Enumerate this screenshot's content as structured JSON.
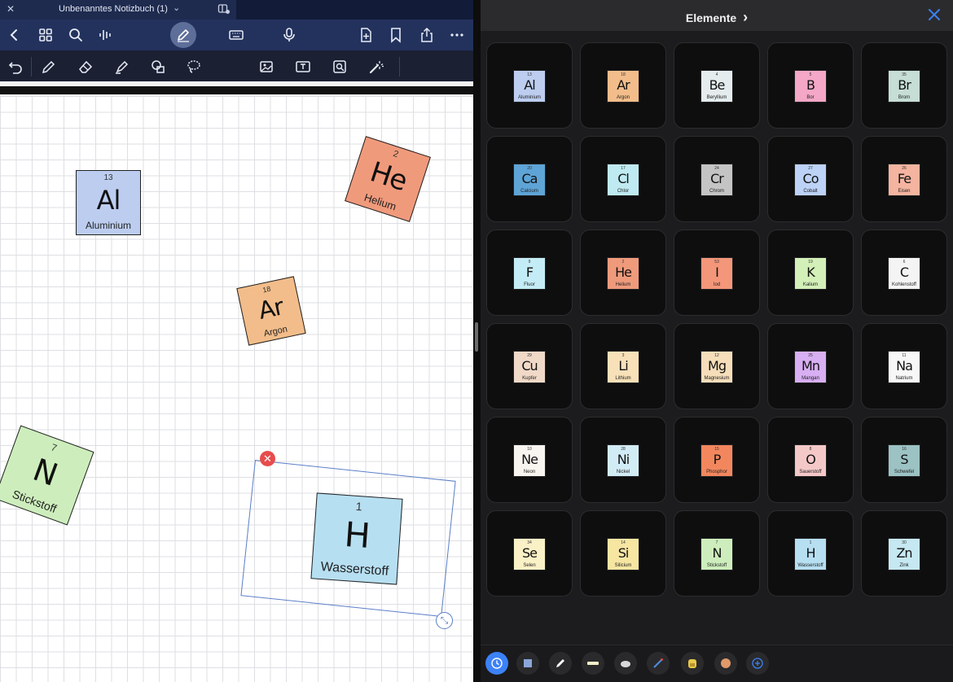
{
  "notebook": {
    "title": "Unbenanntes Notizbuch (1)",
    "title_chevron": "⌄"
  },
  "canvas_tiles": [
    {
      "symbol": "Al",
      "number": "13",
      "name": "Aluminium",
      "color": "#bccdf0"
    },
    {
      "symbol": "He",
      "number": "2",
      "name": "Helium",
      "color": "#f09a7c"
    },
    {
      "symbol": "Ar",
      "number": "18",
      "name": "Argon",
      "color": "#f2bd8a"
    },
    {
      "symbol": "N",
      "number": "7",
      "name": "Stickstoff",
      "color": "#cdeebc"
    },
    {
      "symbol": "H",
      "number": "1",
      "name": "Wasserstoff",
      "color": "#b7dff2"
    }
  ],
  "panel": {
    "title": "Elemente",
    "title_chevron": "›"
  },
  "elements": [
    {
      "symbol": "Al",
      "number": "13",
      "name": "Aluminium",
      "color": "#bccdf0"
    },
    {
      "symbol": "Ar",
      "number": "18",
      "name": "Argon",
      "color": "#f2bd8a"
    },
    {
      "symbol": "Be",
      "number": "4",
      "name": "Beryllium",
      "color": "#e4ecee"
    },
    {
      "symbol": "B",
      "number": "5",
      "name": "Bor",
      "color": "#f4a7c6"
    },
    {
      "symbol": "Br",
      "number": "35",
      "name": "Brom",
      "color": "#c6ded6"
    },
    {
      "symbol": "Ca",
      "number": "20",
      "name": "Calcium",
      "color": "#5ea4d6"
    },
    {
      "symbol": "Cl",
      "number": "17",
      "name": "Chlor",
      "color": "#bfeaf1"
    },
    {
      "symbol": "Cr",
      "number": "24",
      "name": "Chrom",
      "color": "#c4c4c4"
    },
    {
      "symbol": "Co",
      "number": "27",
      "name": "Cobalt",
      "color": "#bcd2f6"
    },
    {
      "symbol": "Fe",
      "number": "26",
      "name": "Eisen",
      "color": "#f5b4a0"
    },
    {
      "symbol": "F",
      "number": "9",
      "name": "Fluor",
      "color": "#c4ecf6"
    },
    {
      "symbol": "He",
      "number": "2",
      "name": "Helium",
      "color": "#f09a7c"
    },
    {
      "symbol": "I",
      "number": "53",
      "name": "Iod",
      "color": "#f3967a"
    },
    {
      "symbol": "K",
      "number": "19",
      "name": "Kalium",
      "color": "#d3f0b8"
    },
    {
      "symbol": "C",
      "number": "6",
      "name": "Kohlenstoff",
      "color": "#f4f4f4"
    },
    {
      "symbol": "Cu",
      "number": "29",
      "name": "Kupfer",
      "color": "#f1d9c8"
    },
    {
      "symbol": "Li",
      "number": "3",
      "name": "Lithium",
      "color": "#f8e1b8"
    },
    {
      "symbol": "Mg",
      "number": "12",
      "name": "Magnesium",
      "color": "#f6deba"
    },
    {
      "symbol": "Mn",
      "number": "25",
      "name": "Mangan",
      "color": "#d8aff2"
    },
    {
      "symbol": "Na",
      "number": "11",
      "name": "Natrium",
      "color": "#f7f7f7"
    },
    {
      "symbol": "Ne",
      "number": "10",
      "name": "Neon",
      "color": "#f8f4f0"
    },
    {
      "symbol": "Ni",
      "number": "28",
      "name": "Nickel",
      "color": "#d2ecf6"
    },
    {
      "symbol": "P",
      "number": "15",
      "name": "Phosphor",
      "color": "#f2875e"
    },
    {
      "symbol": "O",
      "number": "8",
      "name": "Sauerstoff",
      "color": "#f5c8c8"
    },
    {
      "symbol": "S",
      "number": "16",
      "name": "Schwefel",
      "color": "#9cc2c4"
    },
    {
      "symbol": "Se",
      "number": "34",
      "name": "Selen",
      "color": "#fbf1c6"
    },
    {
      "symbol": "Si",
      "number": "14",
      "name": "Silicium",
      "color": "#f6e6a2"
    },
    {
      "symbol": "N",
      "number": "7",
      "name": "Stickstoff",
      "color": "#cdeebc"
    },
    {
      "symbol": "H",
      "number": "1",
      "name": "Wasserstoff",
      "color": "#b7dff2"
    },
    {
      "symbol": "Zn",
      "number": "30",
      "name": "Zink",
      "color": "#c6e8f2"
    }
  ],
  "toolbar_icons": [
    "back-icon",
    "grid-icon",
    "search-icon",
    "audio-icon",
    "pen-mode-icon",
    "keyboard-icon",
    "microphone-icon",
    "add-page-icon",
    "bookmark-icon",
    "share-icon",
    "more-icon"
  ],
  "tool_icons": [
    "undo-icon",
    "pen-icon",
    "eraser-icon",
    "highlighter-icon",
    "shapes-icon",
    "lasso-icon",
    "sticker-icon",
    "image-icon",
    "textbox-icon",
    "camera-icon",
    "laser-icon"
  ],
  "colors": {
    "titlebar": "#1e2b4f",
    "toolbar": "#23325d",
    "accent": "#3c82f6",
    "selection": "#5b7ec9",
    "close_red": "#e74c4c"
  }
}
